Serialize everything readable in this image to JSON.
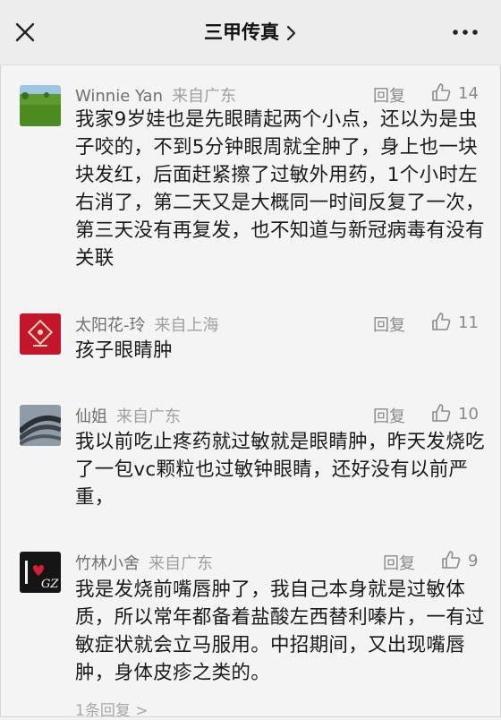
{
  "header": {
    "title": "三甲传真",
    "close_icon": "close-icon",
    "more_icon": "more-icon",
    "title_chevron_icon": "chevron-right-icon"
  },
  "colors": {
    "header_bg": "#ededed",
    "page_bg": "#f4f4f4",
    "username": "#6f6f6f",
    "meta": "#8a8a8a"
  },
  "comments": [
    {
      "username": "Winnie Yan",
      "location": "来自广东",
      "reply_label": "回复",
      "likes": "14",
      "avatar_icon": "grass-field-avatar",
      "text": "我家9岁娃也是先眼睛起两个小点，还以为是虫子咬的，不到5分钟眼周就全肿了，身上也一块块发红，后面赶紧擦了过敏外用药，1个小时左右消了，第二天又是大概同一时间反复了一次，第三天没有再复发，也不知道与新冠病毒有没有关联"
    },
    {
      "username": "太阳花-玲",
      "location": "来自上海",
      "reply_label": "回复",
      "likes": "11",
      "avatar_icon": "red-pattern-avatar",
      "text": "孩子眼睛肿"
    },
    {
      "username": "仙姐",
      "location": "来自广东",
      "reply_label": "回复",
      "likes": "10",
      "avatar_icon": "overpass-avatar",
      "text": "我以前吃止疼药就过敏就是眼睛肿，昨天发烧吃了一包vc颗粒也过敏钟眼睛，还好没有以前严重，"
    },
    {
      "username": "竹林小舍",
      "location": "来自广东",
      "reply_label": "回复",
      "likes": "9",
      "avatar_icon": "heart-logo-avatar",
      "avatar_text": "GZ",
      "text": "我是发烧前嘴唇肿了，我自己本身就是过敏体质，所以常年都备着盐酸左西替利嗪片，一有过敏症状就会立马服用。中招期间，又出现嘴唇肿，身体皮疹之类的。",
      "replies_link": "1条回复 >"
    }
  ]
}
